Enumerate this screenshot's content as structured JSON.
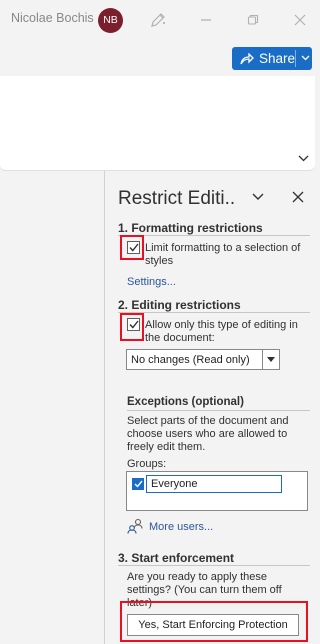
{
  "titlebar": {
    "user_name": "Nicolae Bochis",
    "avatar_initials": "NB",
    "avatar_color": "#7a1f2b"
  },
  "ribbon": {
    "share_label": "Share",
    "accent_color": "#1a6dc7"
  },
  "pane": {
    "title": "Restrict Editi..",
    "formatting": {
      "heading": "1. Formatting restrictions",
      "checkbox_label": "Limit formatting to a selection of styles",
      "checked": true,
      "settings_link": "Settings..."
    },
    "editing": {
      "heading": "2. Editing restrictions",
      "checkbox_label": "Allow only this type of editing in the document:",
      "checked": true,
      "selected_option": "No changes (Read only)",
      "exceptions_heading": "Exceptions (optional)",
      "exceptions_text": "Select parts of the document and choose users who are allowed to freely edit them.",
      "groups_label": "Groups:",
      "groups": [
        {
          "name": "Everyone",
          "checked": true
        }
      ],
      "more_users_link": "More users..."
    },
    "enforcement": {
      "heading": "3. Start enforcement",
      "question": "Are you ready to apply these settings? (You can turn them off later)",
      "button_label": "Yes, Start Enforcing Protection"
    }
  },
  "highlight_color": "#e81123"
}
